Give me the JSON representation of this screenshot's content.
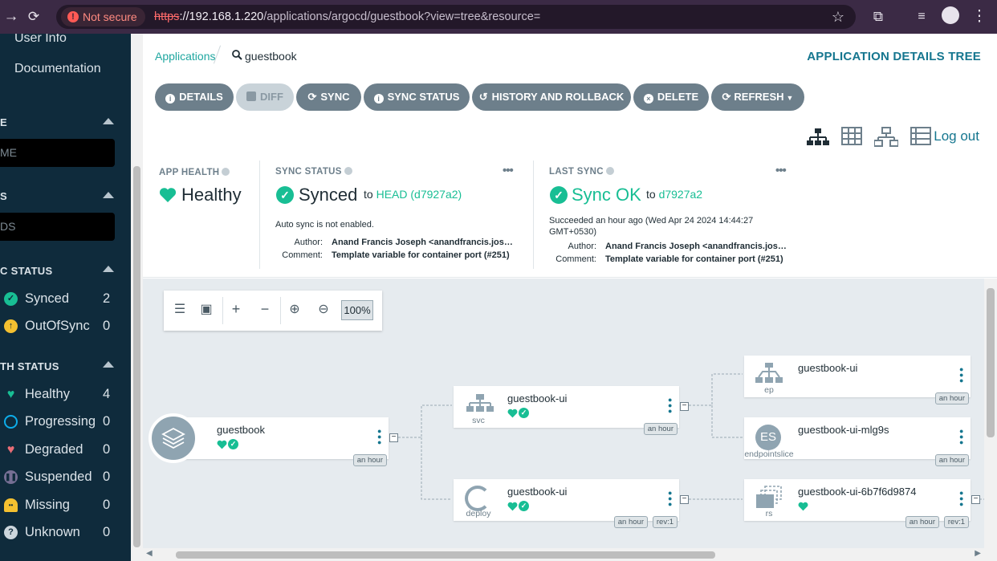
{
  "browser": {
    "security_label": "Not secure",
    "url_protocol": "https",
    "url_host": "://192.168.1.220",
    "url_path": "/applications/argocd/guestbook?view=tree&resource="
  },
  "sidebar": {
    "links": [
      "User Info",
      "Documentation"
    ],
    "name_section": {
      "heading": "E",
      "placeholder": "ME"
    },
    "kinds_section": {
      "heading": "S",
      "placeholder": "DS"
    },
    "sync_status": {
      "heading": "C STATUS",
      "items": [
        {
          "label": "Synced",
          "count": "2",
          "color": "#18be94",
          "icon": "check-circle-icon"
        },
        {
          "label": "OutOfSync",
          "count": "0",
          "color": "#f4c030",
          "icon": "arrow-up-circle-icon"
        }
      ]
    },
    "health_status": {
      "heading": "TH STATUS",
      "items": [
        {
          "label": "Healthy",
          "count": "4",
          "color": "#18be94",
          "icon": "heart-icon"
        },
        {
          "label": "Progressing",
          "count": "0",
          "color": "#0dadea",
          "icon": "circle-notch-icon"
        },
        {
          "label": "Degraded",
          "count": "0",
          "color": "#e96d76",
          "icon": "broken-heart-icon"
        },
        {
          "label": "Suspended",
          "count": "0",
          "color": "#766f94",
          "icon": "pause-circle-icon"
        },
        {
          "label": "Missing",
          "count": "0",
          "color": "#f4c030",
          "icon": "ghost-icon"
        },
        {
          "label": "Unknown",
          "count": "0",
          "color": "#ccd6dd",
          "icon": "question-circle-icon"
        }
      ]
    }
  },
  "header": {
    "breadcrumb_root": "Applications",
    "breadcrumb_current": "guestbook",
    "title": "APPLICATION DETAILS TREE",
    "logout": "Log out"
  },
  "toolbar": {
    "details": "DETAILS",
    "diff": "DIFF",
    "sync": "SYNC",
    "sync_status": "SYNC STATUS",
    "history": "HISTORY AND ROLLBACK",
    "delete": "DELETE",
    "refresh": "REFRESH"
  },
  "status": {
    "app_health": {
      "title": "APP HEALTH",
      "value": "Healthy"
    },
    "sync_status": {
      "title": "SYNC STATUS",
      "value": "Synced",
      "to_prefix": "to",
      "to_ref": "HEAD (d7927a2)",
      "auto_sync": "Auto sync is not enabled.",
      "author_label": "Author:",
      "author": "Anand Francis Joseph <anandfrancis.josep…",
      "comment_label": "Comment:",
      "comment": "Template variable for container port (#251)"
    },
    "last_sync": {
      "title": "LAST SYNC",
      "value": "Sync OK",
      "to_prefix": "to",
      "to_ref": "d7927a2",
      "succeeded": "Succeeded an hour ago (Wed Apr 24 2024 14:44:27 GMT+0530)",
      "author_label": "Author:",
      "author": "Anand Francis Joseph <anandfrancis.josep…",
      "comment_label": "Comment:",
      "comment": "Template variable for container port (#251)"
    },
    "accent": "#18be94"
  },
  "graph": {
    "zoom": "100%",
    "nodes": {
      "app": {
        "name": "guestbook",
        "age": "an hour"
      },
      "svc": {
        "name": "guestbook-ui",
        "kind": "svc",
        "age": "an hour"
      },
      "deploy": {
        "name": "guestbook-ui",
        "kind": "deploy",
        "age": "an hour",
        "rev": "rev:1"
      },
      "ep": {
        "name": "guestbook-ui",
        "kind": "ep",
        "age": "an hour"
      },
      "eps": {
        "name": "guestbook-ui-mlg9s",
        "kind": "endpointslice",
        "badge": "ES",
        "age": "an hour"
      },
      "rs": {
        "name": "guestbook-ui-6b7f6d9874",
        "kind": "rs",
        "age": "an hour",
        "rev": "rev:1"
      }
    }
  }
}
